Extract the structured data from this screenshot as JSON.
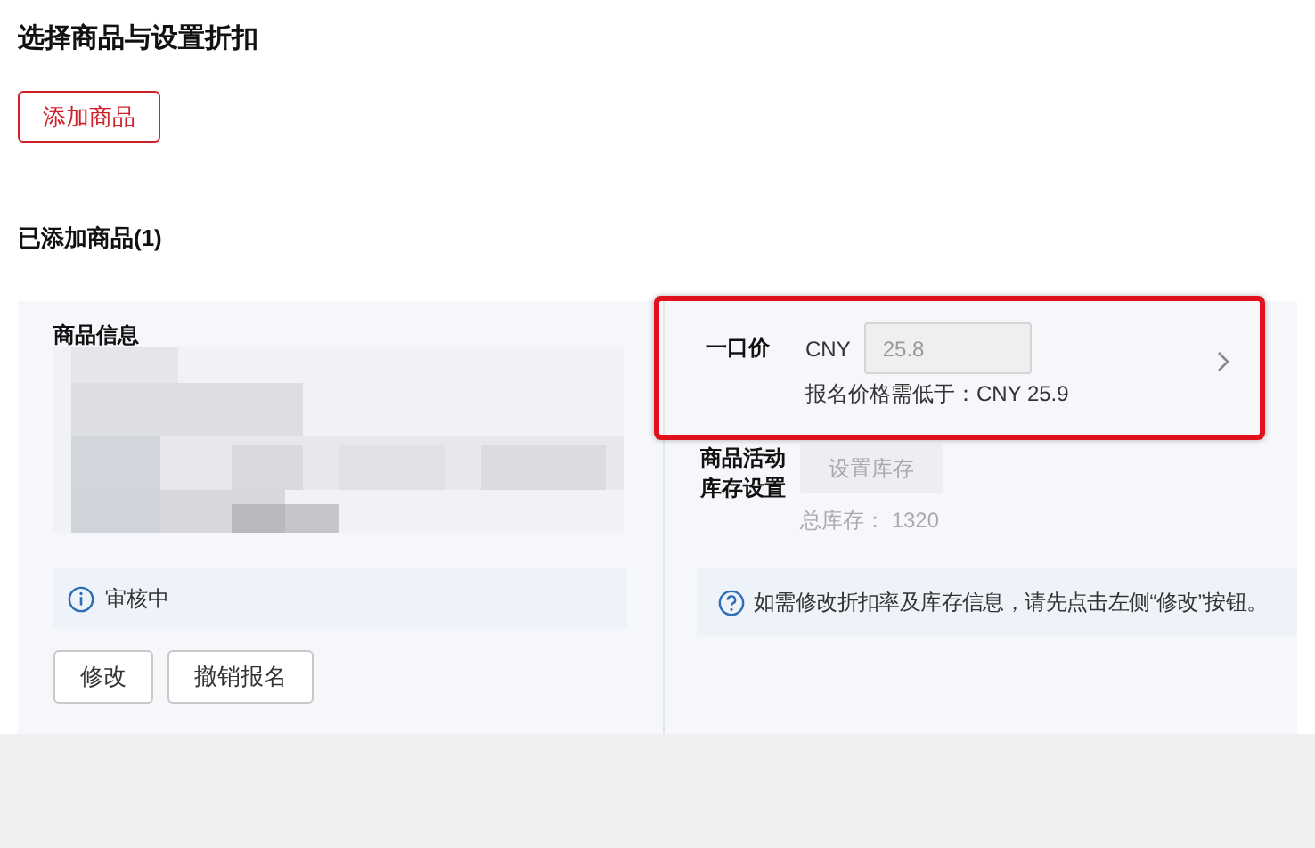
{
  "heading": "选择商品与设置折扣",
  "add_button": "添加商品",
  "added_title": "已添加商品(1)",
  "product": {
    "label": "商品信息",
    "status": "审核中",
    "buttons": [
      "修改",
      "撤销报名"
    ]
  },
  "price": {
    "label": "一口价",
    "currency": "CNY",
    "value": "25.8",
    "disabled": true,
    "hint": "报名价格需低于：CNY 25.9",
    "highlighted": true
  },
  "stock": {
    "label_lines": [
      "商品活动",
      "库存设置"
    ],
    "button": "设置库存",
    "button_disabled": true,
    "total": "总库存： 1320"
  },
  "notice": "如需修改折扣率及库存信息，请先点击左侧“修改”按钮。"
}
